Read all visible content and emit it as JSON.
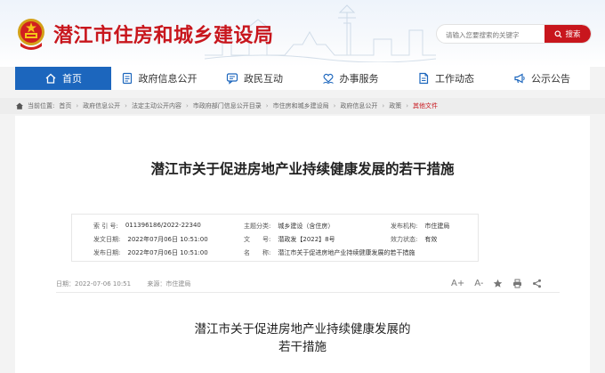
{
  "header": {
    "site_title": "潜江市住房和城乡建设局",
    "search_placeholder": "请输入您要搜索的关键字",
    "search_button": "搜索"
  },
  "nav": [
    {
      "label": "首页",
      "icon": "home-icon",
      "active": true
    },
    {
      "label": "政府信息公开",
      "icon": "document-icon"
    },
    {
      "label": "政民互动",
      "icon": "chat-icon"
    },
    {
      "label": "办事服务",
      "icon": "heart-hand-icon"
    },
    {
      "label": "工作动态",
      "icon": "file-icon"
    },
    {
      "label": "公示公告",
      "icon": "megaphone-icon"
    }
  ],
  "breadcrumb": {
    "prefix": "当前位置:",
    "items": [
      "首页",
      "政府信息公开",
      "法定主动公开内容",
      "市政府部门信息公开目录",
      "市住房和城乡建设局",
      "政府信息公开",
      "政策",
      "其他文件"
    ]
  },
  "article": {
    "title": "潜江市关于促进房地产业持续健康发展的若干措施",
    "meta": {
      "index_label": "索 引 号:",
      "index_value": "011396186/2022-22340",
      "category_label": "主题分类:",
      "category_value": "城乡建设（含住房）",
      "org_label": "发布机构:",
      "org_value": "市住建局",
      "written_label": "发文日期:",
      "written_value": "2022年07月06日 10:51:00",
      "doc_no_label": "文　　号:",
      "doc_no_value": "潜政发【2022】8号",
      "status_label": "效力状态:",
      "status_value": "有效",
      "published_label": "发布日期:",
      "published_value": "2022年07月06日 10:51:00",
      "name_label": "名　　称:",
      "name_value": "潜江市关于促进房地产业持续健康发展的若干措施"
    },
    "date_line": "日期：2022-07-06 10:51",
    "source_line": "来源：市住建局",
    "tools": {
      "font_larger": "A+",
      "font_smaller": "A-"
    },
    "body_title_line1": "潜江市关于促进房地产业持续健康发展的",
    "body_title_line2": "若干措施"
  }
}
